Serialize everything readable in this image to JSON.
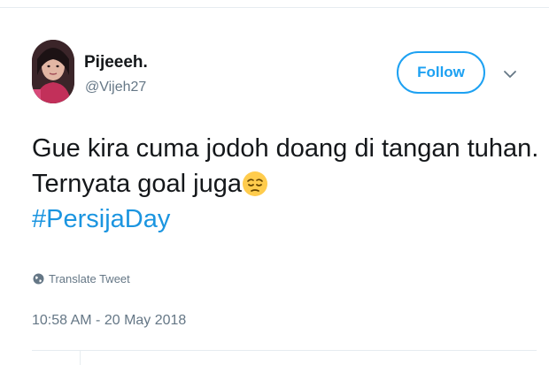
{
  "user": {
    "display_name": "Pijeeeh.",
    "handle": "@Vijeh27",
    "avatar_icon": "avatar"
  },
  "actions": {
    "follow_label": "Follow",
    "more_icon": "chevron-down-icon"
  },
  "tweet": {
    "line1": "Gue kira cuma jodoh doang di tangan tuhan.",
    "line2": "Ternyata goal juga",
    "emoji_icon": "pensive-face-icon",
    "hashtag": "#PersijaDay",
    "translate_label": "Translate Tweet",
    "timestamp": "10:58 AM - 20 May 2018"
  },
  "colors": {
    "link": "#1b95e0",
    "follow": "#1da1f2",
    "text": "#14171a",
    "muted": "#657786"
  }
}
